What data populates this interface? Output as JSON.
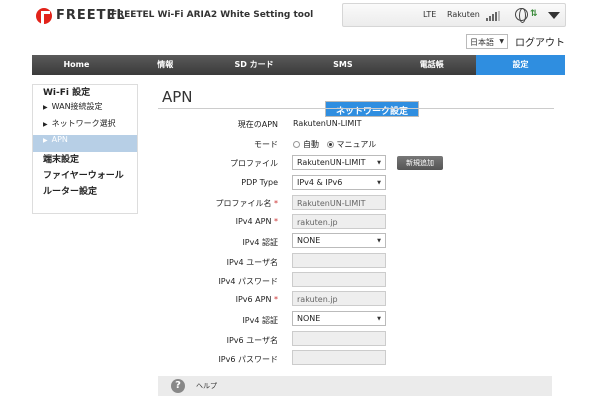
{
  "header": {
    "brand": "FREETEL",
    "app_title": "FREETEL Wi-Fi ARIA2 White Setting tool",
    "network_type": "LTE",
    "carrier": "Rakuten",
    "language": "日本語",
    "logout": "ログアウト"
  },
  "nav": {
    "tabs": [
      "Home",
      "情報",
      "SD カード",
      "SMS",
      "電話帳",
      "設定"
    ]
  },
  "sidebar": {
    "wifi": "Wi-Fi 設定",
    "network": "ネットワーク設定",
    "wan": "WAN接続設定",
    "network_select": "ネットワーク選択",
    "apn": "APN",
    "device": "端末設定",
    "firewall": "ファイヤーウォール",
    "router": "ルーター設定"
  },
  "page": {
    "title": "APN",
    "current_apn_label": "現在のAPN",
    "current_apn_value": "RakutenUN-LIMIT",
    "mode_label": "モード",
    "mode_auto": "自動",
    "mode_manual": "マニュアル",
    "profile_label": "プロファイル",
    "profile_value": "RakutenUN-LIMIT",
    "new_button": "新規追加",
    "pdp_label": "PDP Type",
    "pdp_value": "IPv4 & IPv6",
    "profile_name_label": "プロファイル名",
    "profile_name_value": "RakutenUN-LIMIT",
    "ipv4_apn_label": "IPv4 APN",
    "ipv4_apn_value": "rakuten.jp",
    "ipv4_auth_label": "IPv4 認証",
    "ipv4_auth_value": "NONE",
    "ipv4_user_label": "IPv4 ユーザ名",
    "ipv4_pass_label": "IPv4 パスワード",
    "ipv6_apn_label": "IPv6 APN",
    "ipv6_apn_value": "rakuten.jp",
    "ipv6_auth_label": "IPv4 認証",
    "ipv6_auth_value": "NONE",
    "ipv6_user_label": "IPv6 ユーザ名",
    "ipv6_pass_label": "IPv6 パスワード",
    "required_mark": "*"
  },
  "help": {
    "icon": "?",
    "label": "ヘルプ"
  }
}
